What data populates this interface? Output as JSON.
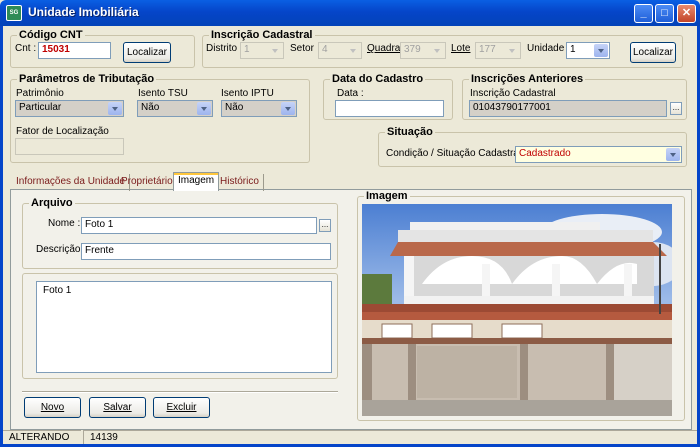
{
  "window": {
    "title": "Unidade Imobiliária",
    "icon_text": "SG"
  },
  "codigo_cnt": {
    "legend": "Código CNT",
    "cnt_label": "Cnt :",
    "cnt_value": "15031",
    "localizar": "Localizar"
  },
  "inscricao_cadastral": {
    "legend": "Inscrição Cadastral",
    "distrito_label": "Distrito",
    "distrito": "1",
    "setor_label": "Setor",
    "setor": "4",
    "quadra_label": "Quadra",
    "quadra": "379",
    "lote_label": "Lote",
    "lote": "177",
    "unidade_label": "Unidade",
    "unidade": "1",
    "localizar": "Localizar"
  },
  "parametros": {
    "legend": "Parâmetros de Tributação",
    "patrimonio_label": "Patrimônio",
    "patrimonio": "Particular",
    "isento_tsu_label": "Isento  TSU",
    "isento_tsu": "Não",
    "isento_iptu_label": "Isento  IPTU",
    "isento_iptu": "Não",
    "fator_label": "Fator de Localização",
    "fator": ""
  },
  "data_cadastro": {
    "legend": "Data do Cadastro",
    "data_label": "Data :",
    "data": ""
  },
  "inscricoes_anteriores": {
    "legend": "Inscrições Anteriores",
    "label": "Inscrição Cadastral",
    "value": "01043790177001"
  },
  "situacao": {
    "legend": "Situação",
    "label": "Condição / Situação Cadastral :",
    "value": "Cadastrado",
    "value_color": "#C00000"
  },
  "tabs": [
    {
      "label": "Informações da Unidade"
    },
    {
      "label": "Proprietários"
    },
    {
      "label": "Imagem"
    },
    {
      "label": "Histórico"
    }
  ],
  "arquivo": {
    "legend": "Arquivo",
    "nome_label": "Nome :",
    "nome": "Foto 1",
    "descricao_label": "Descrição :",
    "descricao": "Frente",
    "list_items": [
      "Foto 1"
    ]
  },
  "imagem": {
    "legend": "Imagem"
  },
  "buttons": {
    "novo": "Novo",
    "salvar": "Salvar",
    "excluir": "Excluir"
  },
  "status": {
    "mode": "ALTERANDO",
    "code": "14139"
  },
  "colors": {
    "title_bar": "#0545C9",
    "window_bg": "#ECE9D8",
    "tab_label": "#7A1A1A"
  }
}
